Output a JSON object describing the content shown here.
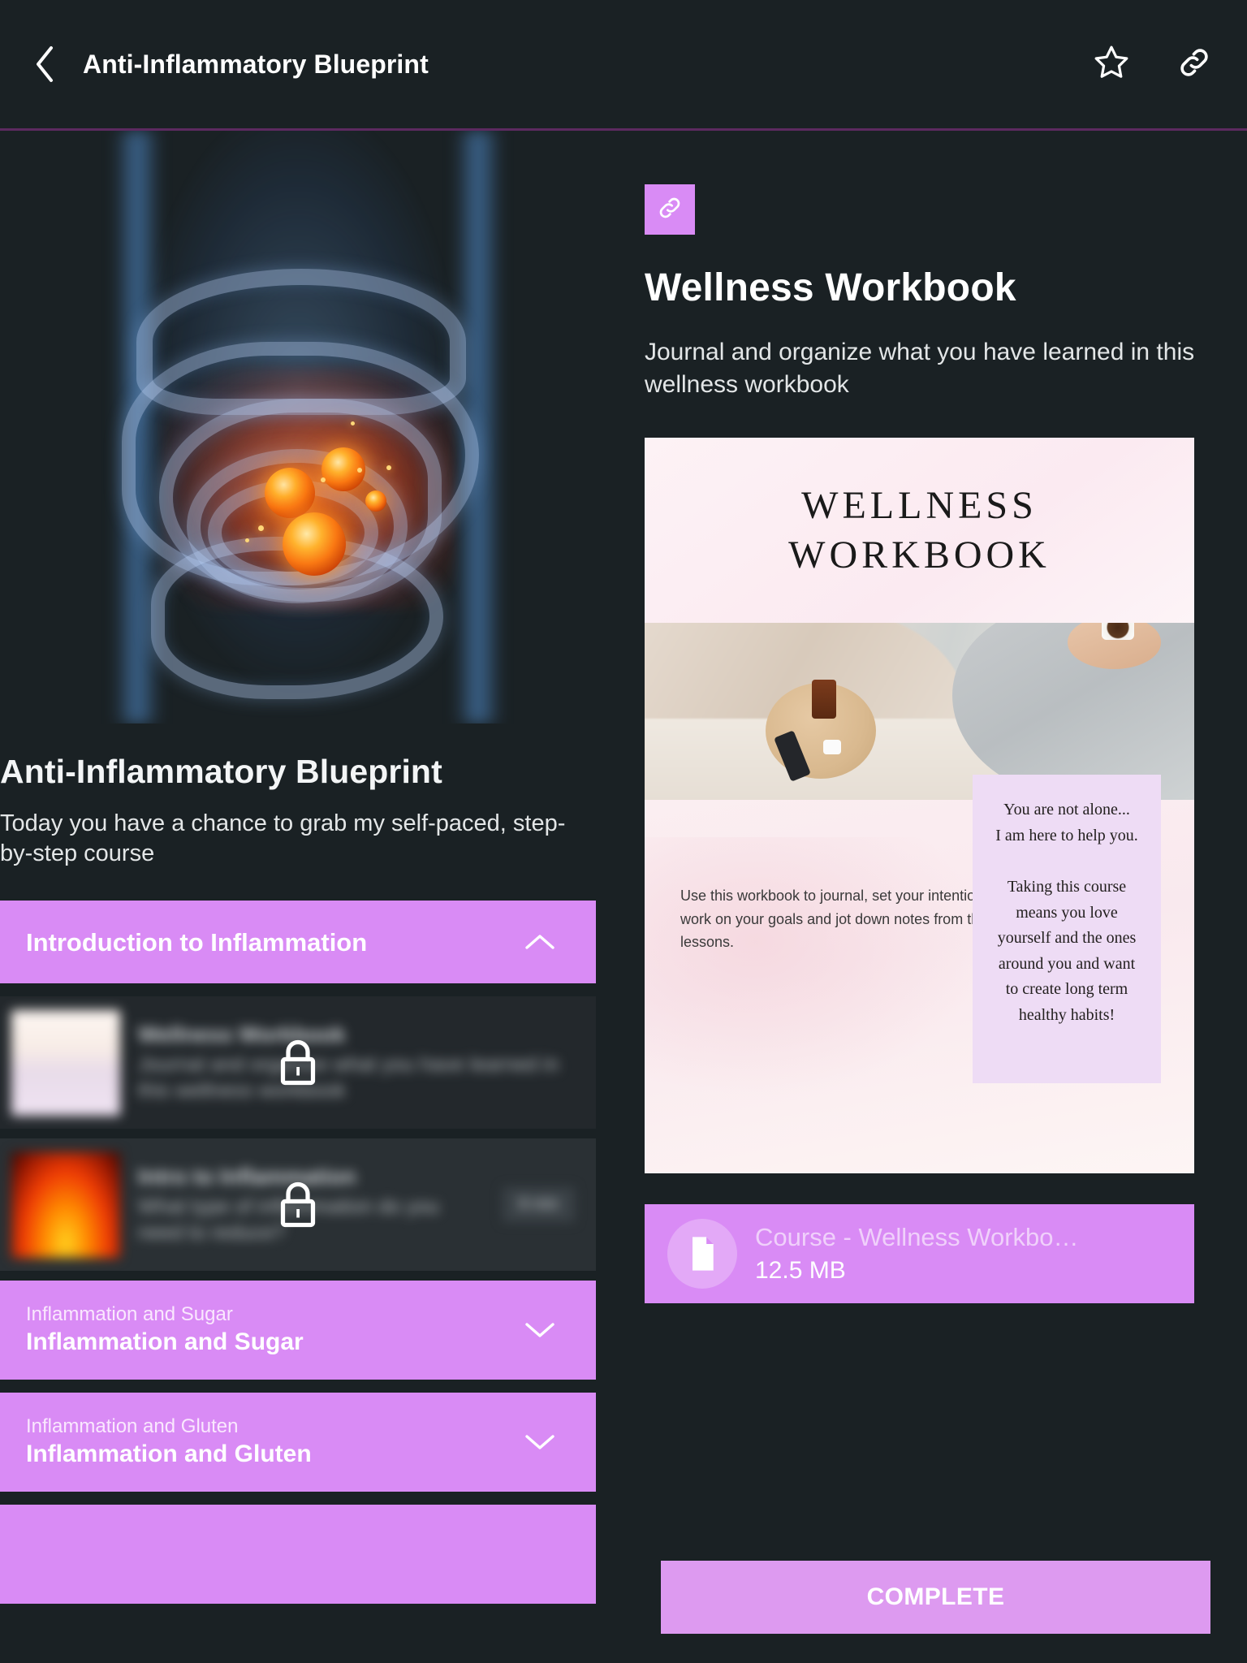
{
  "topbar": {
    "back_icon": "chevron-left-icon",
    "title": "Anti-Inflammatory Blueprint",
    "favorite_icon": "star-icon",
    "share_icon": "link-icon"
  },
  "course": {
    "hero_image_alt": "inflamed-digestive-system-illustration",
    "title": "Anti-Inflammatory Blueprint",
    "description": "Today you have a chance to grab my self-paced, step-by-step course"
  },
  "sections": [
    {
      "subtitle": "",
      "title": "Introduction to Inflammation",
      "expanded": true,
      "chevron": "chevron-up-icon",
      "lessons": [
        {
          "thumb": "workbook-thumbnail",
          "title": "Wellness Workbook",
          "description": "Journal and organize what you have learned in this wellness workbook",
          "badge": "",
          "locked": true,
          "lock_icon": "lock-icon"
        },
        {
          "thumb": "fire-thumbnail",
          "title": "Intro to Inflammation",
          "description": "What type of inflammation do you need to reduce?",
          "badge": "8 min",
          "locked": true,
          "lock_icon": "lock-icon"
        }
      ]
    },
    {
      "subtitle": "Inflammation and Sugar",
      "title": "Inflammation and Sugar",
      "expanded": false,
      "chevron": "chevron-down-icon",
      "lessons": []
    },
    {
      "subtitle": "Inflammation and Gluten",
      "title": "Inflammation and Gluten",
      "expanded": false,
      "chevron": "chevron-down-icon",
      "lessons": []
    }
  ],
  "detail": {
    "type_icon": "link-icon",
    "title": "Wellness Workbook",
    "description": "Journal and organize what you have learned in this wellness workbook",
    "preview": {
      "heading_line1": "WELLNESS",
      "heading_line2": "WORKBOOK",
      "note": "Use this workbook to journal, set your intentions, work on your goals and jot down notes from the lessons.",
      "card_text": "You are not alone...\nI am here to help you.\n\nTaking this course\nmeans you love\nyourself and the ones\naround you and want\nto create long term\nhealthy habits!"
    },
    "file": {
      "icon": "document-icon",
      "name": "Course - Wellness Workbo…",
      "size": "12.5 MB"
    },
    "complete_label": "COMPLETE"
  },
  "colors": {
    "background": "#1a2124",
    "accent_purple": "#d98bf5",
    "accent_purple_light": "#dd9af0",
    "divider": "#5c2a60",
    "row_background": "#2a3034",
    "text_primary": "#ffffff",
    "text_secondary": "#e3e6e7"
  }
}
